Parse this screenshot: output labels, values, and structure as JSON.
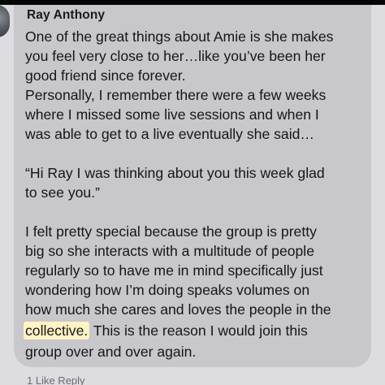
{
  "comment": {
    "author": "Ray Anthony",
    "lines": [
      "One of the great things about Amie is she makes",
      "you feel very close to her…like you’ve been her",
      "good friend since forever.",
      "Personally, I remember there were a few weeks",
      "where I missed some live sessions and when I",
      "was able to get to a live eventually she said…",
      "",
      " “Hi Ray I was thinking about you this week glad",
      "to see you.”",
      "",
      "I felt pretty special because the group is pretty",
      "big so she interacts with a multitude of people",
      "regularly so to have me in mind specifically just",
      "wondering how I’m doing speaks volumes on",
      "how much she cares and loves the people in the"
    ],
    "highlight_word": "collective.",
    "line_after_highlight": " This is the reason I would join this",
    "last_line": "group over and over again."
  },
  "footer": {
    "text": "1 Like Reply"
  },
  "colors": {
    "bubble": "#c7c7cc",
    "background": "#dcdce1",
    "highlight": "#fff3c4"
  }
}
